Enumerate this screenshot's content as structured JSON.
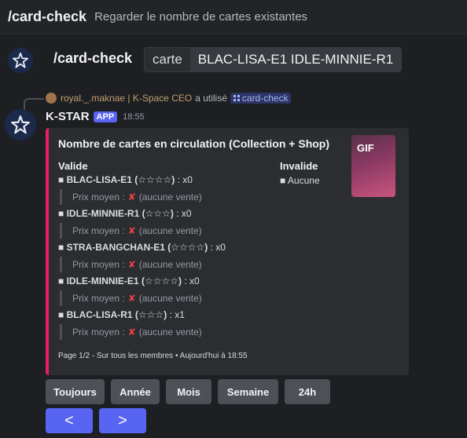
{
  "command_suggestion": {
    "name": "/card-check",
    "description": "Regarder le nombre de cartes existantes"
  },
  "command_input": {
    "command": "/card-check",
    "option_name": "carte",
    "option_value": "BLAC-LISA-E1 IDLE-MINNIE-R1"
  },
  "message": {
    "reply": {
      "user": "royal._.maknae | K-Space CEO",
      "action": "a utilisé",
      "command": "card-check"
    },
    "author": "K-STAR",
    "badge": "APP",
    "time": "18:55",
    "embed": {
      "accent_color": "#e91e63",
      "title": "Nombre de cartes en circulation (Collection + Shop)",
      "thumbnail_label": "GIF",
      "valid_label": "Valide",
      "invalid_label": "Invalide",
      "invalid_value": "■ Aucune",
      "cards": [
        {
          "name": "■ BLAC-LISA-E1",
          "stars": "(☆☆☆☆)",
          "count": ": x0",
          "price_label": "Prix moyen :",
          "price_value": "(aucune vente)"
        },
        {
          "name": "■ IDLE-MINNIE-R1",
          "stars": "(☆☆☆)",
          "count": ": x0",
          "price_label": "Prix moyen :",
          "price_value": "(aucune vente)"
        },
        {
          "name": "■ STRA-BANGCHAN-E1",
          "stars": "(☆☆☆☆)",
          "count": ": x0",
          "price_label": "Prix moyen :",
          "price_value": "(aucune vente)"
        },
        {
          "name": "■ IDLE-MINNIE-E1",
          "stars": "(☆☆☆☆)",
          "count": ": x0",
          "price_label": "Prix moyen :",
          "price_value": "(aucune vente)"
        },
        {
          "name": "■ BLAC-LISA-R1",
          "stars": "(☆☆☆)",
          "count": ": x1",
          "price_label": "Prix moyen :",
          "price_value": "(aucune vente)"
        }
      ],
      "footer": "Page 1/2 - Sur tous les membres • Aujourd'hui à 18:55"
    }
  },
  "filter_buttons": [
    "Toujours",
    "Année",
    "Mois",
    "Semaine",
    "24h"
  ],
  "nav_buttons": {
    "prev": "<",
    "next": ">"
  },
  "icons": {
    "bot_avatar": "star-logo-icon",
    "price_none": "cross-icon",
    "command": "slash-command-icon"
  }
}
